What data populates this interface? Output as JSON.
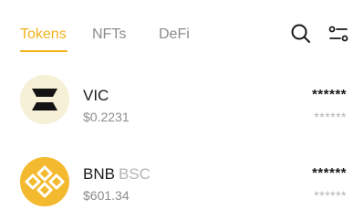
{
  "header": {
    "tabs": [
      {
        "label": "Tokens",
        "active": true
      },
      {
        "label": "NFTs",
        "active": false
      },
      {
        "label": "DeFi",
        "active": false
      }
    ],
    "icons": [
      "search-icon",
      "filter-sliders-icon"
    ],
    "accent_color": "#f2b21b"
  },
  "tokens": [
    {
      "symbol": "VIC",
      "network": "",
      "price": "$0.2231",
      "balance": "******",
      "value": "******",
      "icon": "vic-logo-icon",
      "logo_color": "#f6f0d6"
    },
    {
      "symbol": "BNB",
      "network": "BSC",
      "price": "$601.34",
      "balance": "******",
      "value": "******",
      "icon": "bnb-logo-icon",
      "logo_color": "#f3ba2f"
    }
  ]
}
